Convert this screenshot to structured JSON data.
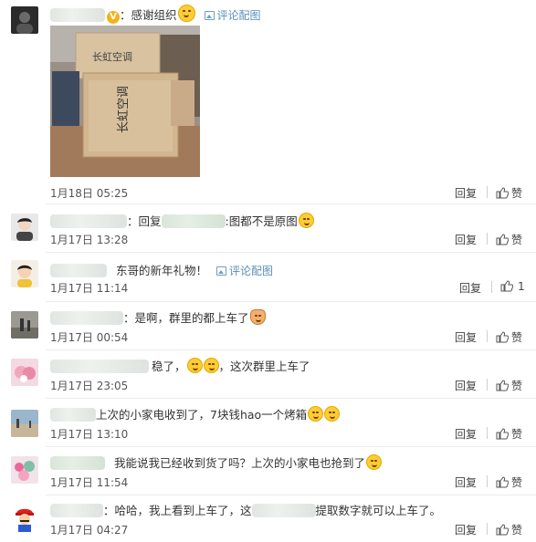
{
  "colors": {
    "link": "#5a8fb9",
    "text": "#333333",
    "meta": "#555555"
  },
  "labels": {
    "reply": "回复",
    "like": "赞",
    "pic_comment": "评论配图"
  },
  "comments": [
    {
      "text": "感谢组织",
      "time": "1月18日 05:25",
      "like_count": "",
      "has_photo": true,
      "photo_text": [
        "长虹空调",
        "长虹空调"
      ]
    },
    {
      "prefix": "：回复",
      "text": ":图都不是原图",
      "time": "1月17日 13:28",
      "like_count": ""
    },
    {
      "text": "东哥的新年礼物！",
      "time": "1月17日 11:14",
      "like_count": "1"
    },
    {
      "text": "：是啊，群里的都上车了",
      "time": "1月17日 00:54",
      "like_count": ""
    },
    {
      "text": "稳了，",
      "text2": "，这次群里上车了",
      "time": "1月17日 23:05",
      "like_count": ""
    },
    {
      "text": "上次的小家电收到了，7块钱hao一个烤箱",
      "time": "1月17日 13:10",
      "like_count": ""
    },
    {
      "text": "我能说我已经收到货了吗？上次的小家电也抢到了",
      "time": "1月17日 11:54",
      "like_count": ""
    },
    {
      "text": "：哈哈，我上看到上车了，这",
      "text2": "提取数字就可以上车了。",
      "time": "1月17日 04:27",
      "like_count": ""
    }
  ]
}
